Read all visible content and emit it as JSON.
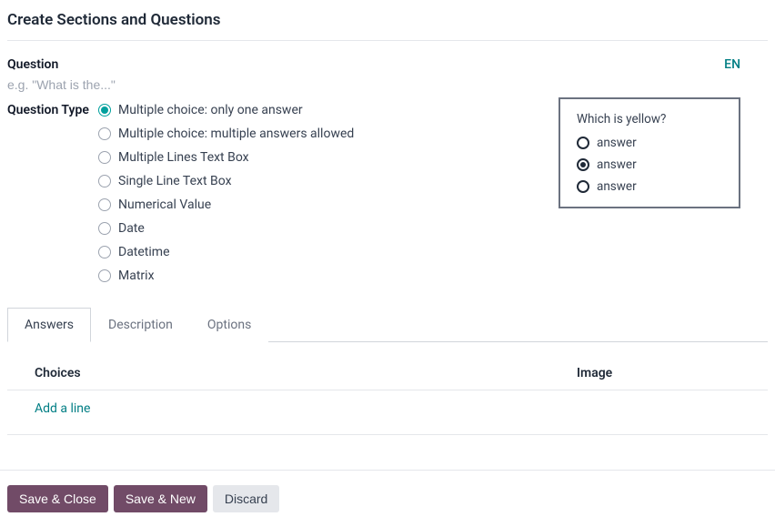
{
  "page_title": "Create Sections and Questions",
  "question": {
    "label": "Question",
    "placeholder": "e.g. \"What is the...\"",
    "value": ""
  },
  "language": "EN",
  "question_type": {
    "label": "Question Type",
    "selected_index": 0,
    "options": [
      "Multiple choice: only one answer",
      "Multiple choice: multiple answers allowed",
      "Multiple Lines Text Box",
      "Single Line Text Box",
      "Numerical Value",
      "Date",
      "Datetime",
      "Matrix"
    ]
  },
  "preview": {
    "question": "Which is yellow?",
    "selected_index": 1,
    "options": [
      "answer",
      "answer",
      "answer"
    ]
  },
  "tabs": {
    "active_index": 0,
    "items": [
      "Answers",
      "Description",
      "Options"
    ]
  },
  "answers_table": {
    "headers": {
      "choices": "Choices",
      "image": "Image"
    },
    "add_line": "Add a line"
  },
  "buttons": {
    "save_close": "Save & Close",
    "save_new": "Save & New",
    "discard": "Discard"
  }
}
